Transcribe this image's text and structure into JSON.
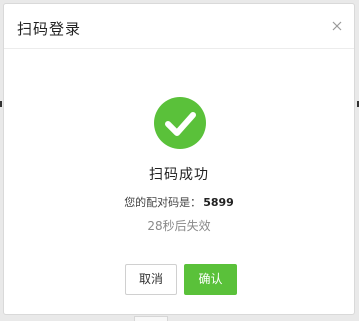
{
  "dialog": {
    "title": "扫码登录",
    "close_icon": "close-icon",
    "status": {
      "icon": "check-circle-icon",
      "icon_color": "#5ac13a",
      "text": "扫码成功"
    },
    "pairing": {
      "label": "您的配对码是：",
      "code": "5899"
    },
    "countdown_text": "28秒后失效",
    "buttons": {
      "cancel_label": "取消",
      "confirm_label": "确认",
      "confirm_color": "#5ac13a"
    }
  }
}
